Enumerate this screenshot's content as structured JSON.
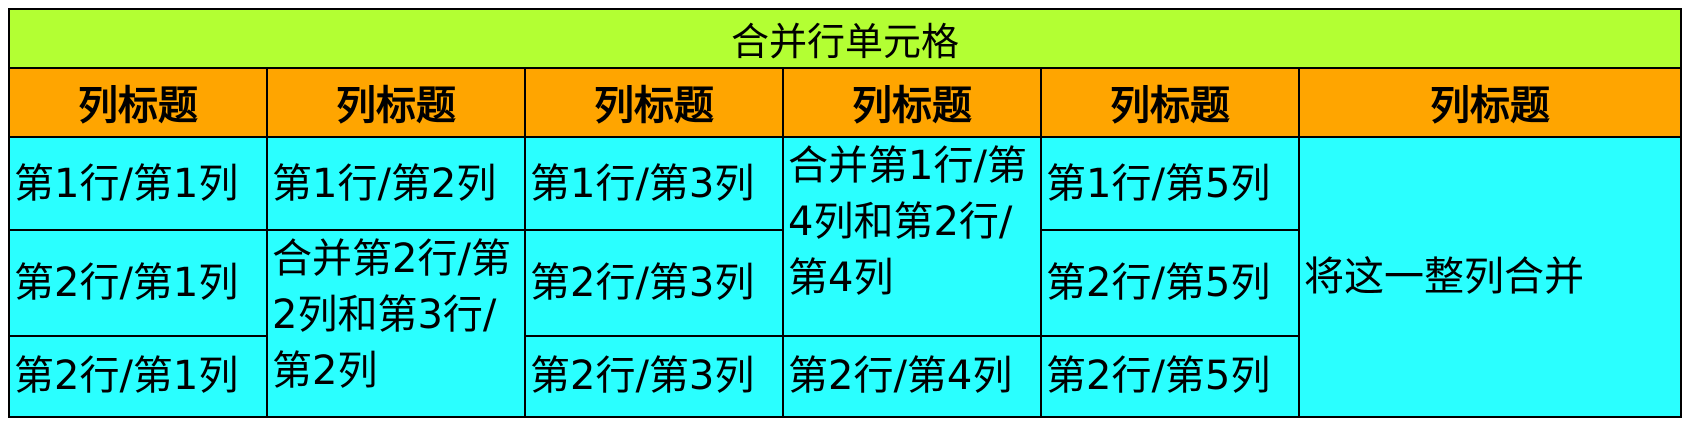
{
  "title": "合并行单元格",
  "headers": [
    "列标题",
    "列标题",
    "列标题",
    "列标题",
    "列标题",
    "列标题"
  ],
  "cells": {
    "r1c1": "第1行/第1列",
    "r1c2": "第1行/第2列",
    "r1c3": "第1行/第3列",
    "r1c4_merged": "合并第1行/第4列和第2行/第4列",
    "r1c5": "第1行/第5列",
    "c6_merged": "将这一整列合并",
    "r2c1": "第2行/第1列",
    "r2c2_merged": "合并第2行/第2列和第3行/第2列",
    "r2c3": "第2行/第3列",
    "r2c5": "第2行/第5列",
    "r3c1": "第2行/第1列",
    "r3c3": "第2行/第3列",
    "r3c4": "第2行/第4列",
    "r3c5": "第2行/第5列"
  },
  "colors": {
    "title_bg": "#b3ff33",
    "header_bg": "#ffa500",
    "body_bg": "#2affff",
    "border": "#000000"
  }
}
